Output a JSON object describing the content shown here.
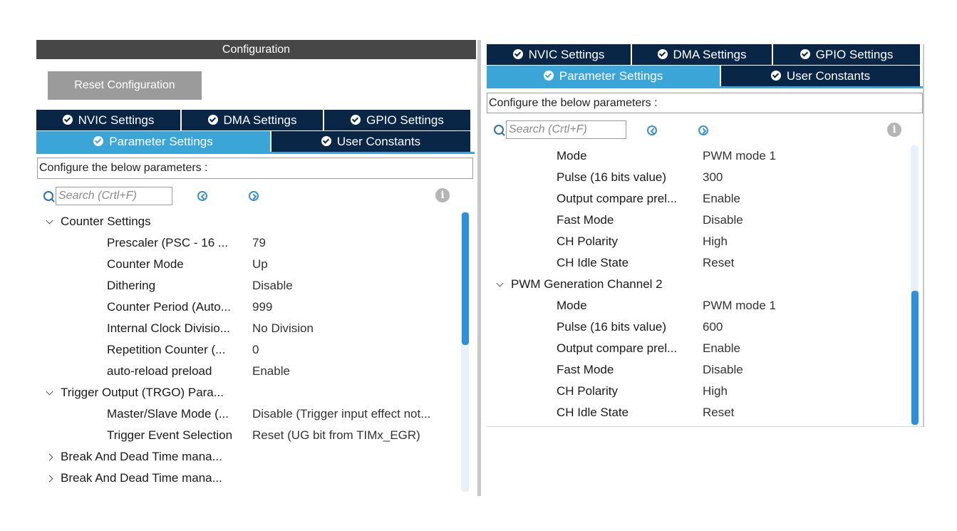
{
  "left": {
    "header": "Configuration",
    "reset_label": "Reset Configuration",
    "tabs_row1": [
      "NVIC Settings",
      "DMA Settings",
      "GPIO Settings"
    ],
    "tabs_row2": [
      "Parameter Settings",
      "User Constants"
    ],
    "configure_text": "Configure the below parameters :",
    "search_placeholder": "Search (Crtl+F)",
    "groups": [
      {
        "title": "Counter Settings",
        "expanded": true,
        "params": [
          {
            "name": "Prescaler (PSC - 16 ...",
            "value": "79"
          },
          {
            "name": "Counter Mode",
            "value": "Up"
          },
          {
            "name": "Dithering",
            "value": "Disable"
          },
          {
            "name": "Counter Period (Auto...",
            "value": "999"
          },
          {
            "name": "Internal Clock Divisio...",
            "value": "No Division"
          },
          {
            "name": "Repetition Counter (...",
            "value": "0"
          },
          {
            "name": "auto-reload preload",
            "value": "Enable"
          }
        ]
      },
      {
        "title": "Trigger Output (TRGO) Para...",
        "expanded": true,
        "params": [
          {
            "name": "Master/Slave Mode (...",
            "value": "Disable (Trigger input effect not..."
          },
          {
            "name": "Trigger Event Selection",
            "value": "Reset (UG bit from TIMx_EGR)"
          }
        ]
      },
      {
        "title": "Break And Dead Time mana...",
        "expanded": false,
        "params": []
      },
      {
        "title": "Break And Dead Time mana...",
        "expanded": false,
        "params": []
      }
    ]
  },
  "right": {
    "tabs_row1": [
      "NVIC Settings",
      "DMA Settings",
      "GPIO Settings"
    ],
    "tabs_row2": [
      "Parameter Settings",
      "User Constants"
    ],
    "configure_text": "Configure the below parameters :",
    "search_placeholder": "Search (Crtl+F)",
    "params_top": [
      {
        "name": "Mode",
        "value": "PWM mode 1"
      },
      {
        "name": "Pulse (16 bits value)",
        "value": "300"
      },
      {
        "name": "Output compare prel...",
        "value": "Enable"
      },
      {
        "name": "Fast Mode",
        "value": "Disable"
      },
      {
        "name": "CH Polarity",
        "value": "High"
      },
      {
        "name": "CH Idle State",
        "value": "Reset"
      }
    ],
    "group2": {
      "title": "PWM Generation Channel 2",
      "params": [
        {
          "name": "Mode",
          "value": "PWM mode 1"
        },
        {
          "name": "Pulse (16 bits value)",
          "value": "600"
        },
        {
          "name": "Output compare prel...",
          "value": "Enable"
        },
        {
          "name": "Fast Mode",
          "value": "Disable"
        },
        {
          "name": "CH Polarity",
          "value": "High"
        },
        {
          "name": "CH Idle State",
          "value": "Reset"
        }
      ]
    }
  },
  "colors": {
    "tab_dark": "#0a2647",
    "tab_active": "#3ba5d8",
    "header": "#474747",
    "button": "#9b9b9b"
  },
  "icons": [
    "check-circle-icon",
    "search-icon",
    "prev-circle-icon",
    "next-circle-icon",
    "info-icon",
    "chevron-down-icon",
    "chevron-right-icon"
  ]
}
